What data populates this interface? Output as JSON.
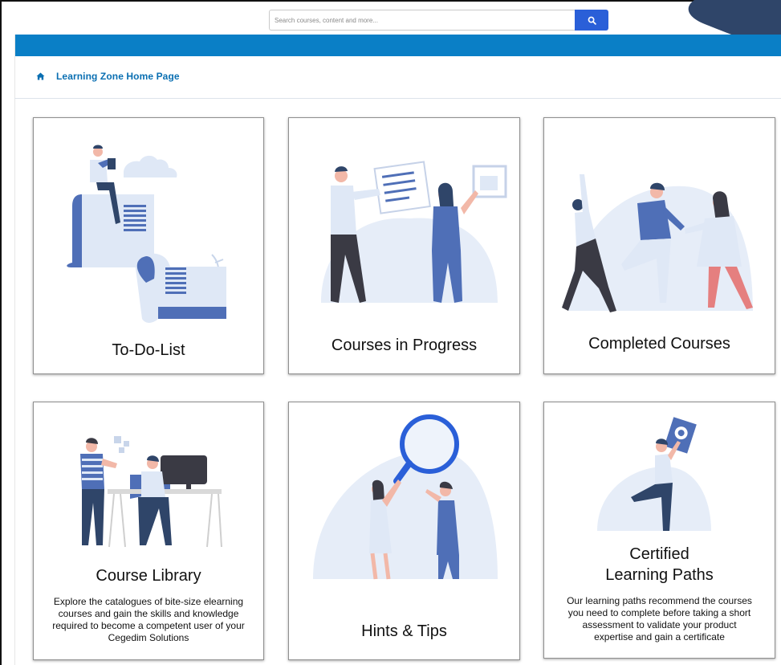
{
  "search": {
    "placeholder": "Search courses, content and more...",
    "button_icon": "search-icon"
  },
  "breadcrumb": {
    "icon": "home-icon",
    "label": "Learning Zone Home Page"
  },
  "colors": {
    "accent_blue": "#0a7fc6",
    "search_button": "#2a5fd8",
    "illustration_blue": "#4f6fb7",
    "illustration_light": "#dfe8f6",
    "corner_navy": "#2f4569"
  },
  "cards": [
    {
      "title": "To-Do-List",
      "description": "",
      "icon": "todo-list-illustration"
    },
    {
      "title": "Courses in Progress",
      "description": "",
      "icon": "courses-in-progress-illustration"
    },
    {
      "title": "Completed Courses",
      "description": "",
      "icon": "completed-courses-illustration"
    },
    {
      "title": "Course Library",
      "description": "Explore the catalogues of bite-size elearning courses and gain the skills and knowledge required to become a competent user of your Cegedim Solutions",
      "icon": "course-library-illustration"
    },
    {
      "title": "Hints & Tips",
      "description": "",
      "icon": "hints-tips-illustration"
    },
    {
      "title": "Certified Learning Paths",
      "description": "Our learning paths recommend the courses you need to complete before taking a short assessment to validate your product expertise and gain a certificate",
      "icon": "certified-paths-illustration"
    }
  ]
}
